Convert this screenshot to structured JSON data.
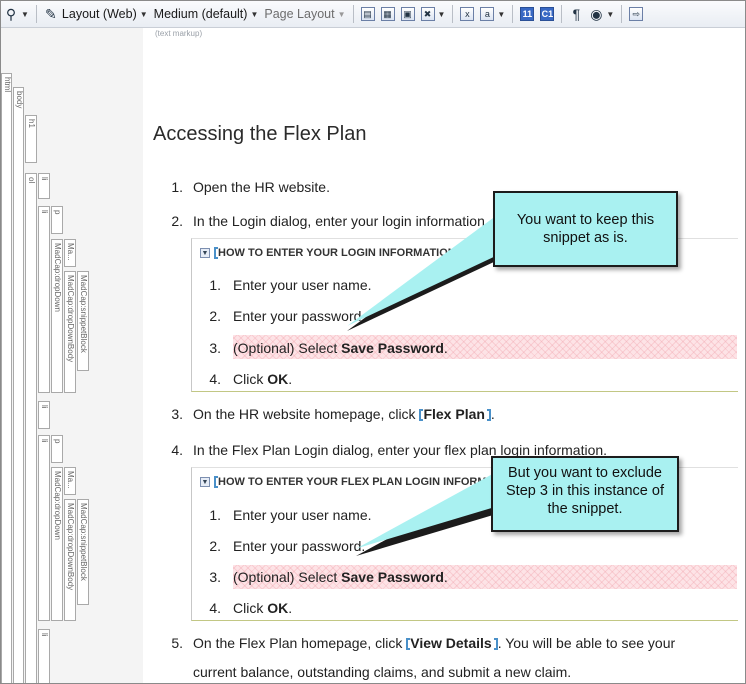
{
  "toolbar": {
    "layout": "Layout (Web)",
    "medium": "Medium (default)",
    "page_layout": "Page Layout",
    "markup_label": "(text markup)"
  },
  "structure_tags": {
    "html": "html",
    "body": "body",
    "h1": "h1",
    "ol": "ol",
    "li": "li",
    "p": "p",
    "dropdown": "MadCap:dropDown",
    "dropdown_head": "Ma...",
    "dropdown_body": "MadCap:dropDownBody",
    "snippet": "MadCap:snippetBlock"
  },
  "document": {
    "title": "Accessing the Flex Plan",
    "steps": [
      {
        "num": "1.",
        "text": "Open the HR website."
      },
      {
        "num": "2.",
        "text": "In the Login dialog, enter your login information."
      },
      {
        "num": "3.",
        "text_before": "On the HR website homepage, click ",
        "link": "Flex Plan",
        "text_after": "."
      },
      {
        "num": "4.",
        "text": "In the Flex Plan Login dialog, enter your flex plan login information."
      },
      {
        "num": "5.",
        "text_before": "On the Flex Plan homepage, click ",
        "link": "View Details",
        "text_after": ". You will be able to see your",
        "line2": "current balance, outstanding claims, and submit a new claim."
      }
    ],
    "snippet1": {
      "heading": "HOW TO ENTER YOUR LOGIN INFORMATION",
      "items": [
        {
          "num": "1.",
          "text": "Enter your user name."
        },
        {
          "num": "2.",
          "text": "Enter your password."
        },
        {
          "num": "3.",
          "text_before": "(Optional) Select ",
          "bold": "Save Password",
          "text_after": "."
        },
        {
          "num": "4.",
          "text_before": "Click ",
          "bold": "OK",
          "text_after": "."
        }
      ]
    },
    "snippet2": {
      "heading": "HOW TO ENTER YOUR FLEX PLAN LOGIN INFORM",
      "items": [
        {
          "num": "1.",
          "text": "Enter your user name."
        },
        {
          "num": "2.",
          "text": "Enter your password."
        },
        {
          "num": "3.",
          "text_before": "(Optional) Select ",
          "bold": "Save Password",
          "text_after": "."
        },
        {
          "num": "4.",
          "text_before": "Click ",
          "bold": "OK",
          "text_after": "."
        }
      ]
    }
  },
  "callouts": {
    "first": "You want to keep this snippet as is.",
    "second": "But you want to exclude Step 3 in this instance of the snippet."
  },
  "colors": {
    "callout_fill": "#a9f1f1",
    "highlight": "#fde3e6",
    "bracket": "#4a90c8"
  }
}
